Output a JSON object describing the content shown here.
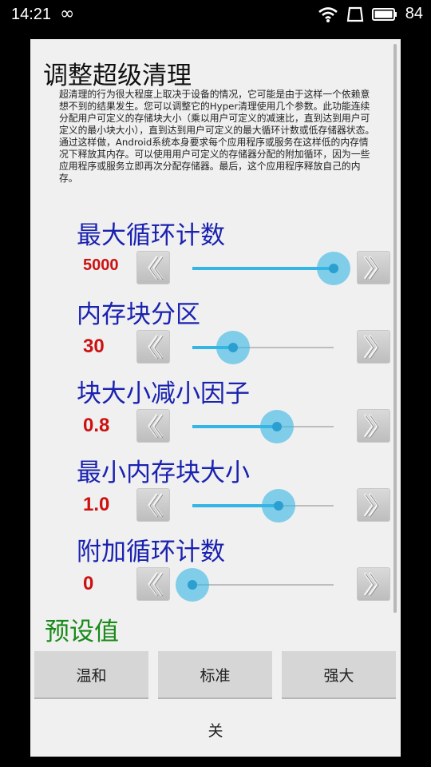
{
  "status_bar": {
    "time": "14:21",
    "battery": "84"
  },
  "dialog": {
    "title": "调整超级清理",
    "description": "超清理的行为很大程度上取决于设备的情况，它可能是由于这样一个依赖意想不到的结果发生。您可以调整它的Hyper清理使用几个参数。此功能连续分配用户可定义的存储块大小（乘以用户可定义的减速比，直到达到用户可定义的最小块大小），直到达到用户可定义的最大循环计数或低存储器状态。通过这样做，Android系统本身要求每个应用程序或服务在这样低的内存情况下释放其内存。可以使用用户可定义的存储器分配的附加循环，因为一些应用程序或服务立即再次分配存储器。最后，这个应用程序释放自己的内存。",
    "settings": [
      {
        "label": "最大循环计数",
        "value": "5000",
        "level": 1.0
      },
      {
        "label": "内存块分区",
        "value": "30",
        "level": 0.29
      },
      {
        "label": "块大小减小因子",
        "value": "0.8",
        "level": 0.6
      },
      {
        "label": "最小内存块大小",
        "value": "1.0",
        "level": 0.61
      },
      {
        "label": "附加循环计数",
        "value": "0",
        "level": 0.0
      }
    ],
    "presets_title": "预设值",
    "presets": [
      "温和",
      "标准",
      "强大"
    ],
    "close_label": "关"
  },
  "colors": {
    "label": "#1a22b0",
    "value": "#cc1111",
    "preset_title": "#1a8a1a",
    "slider": "#33b5e5"
  }
}
